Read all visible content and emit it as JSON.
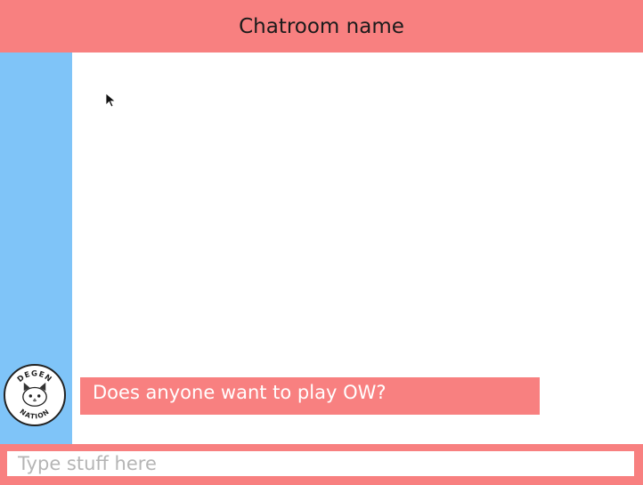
{
  "header": {
    "title": "Chatroom name"
  },
  "messages": [
    {
      "avatar_label_top": "DEGEN",
      "avatar_label_bottom": "NATION",
      "text": "Does anyone want to play OW?"
    }
  ],
  "composer": {
    "placeholder": "Type stuff here",
    "value": ""
  },
  "colors": {
    "header": "#f88080",
    "sidebar": "#7fc4f8",
    "bubble": "#f88080",
    "input_bar": "#f88080"
  },
  "icons": {
    "avatar": "cat-avatar-icon",
    "cursor": "mouse-pointer-icon"
  }
}
